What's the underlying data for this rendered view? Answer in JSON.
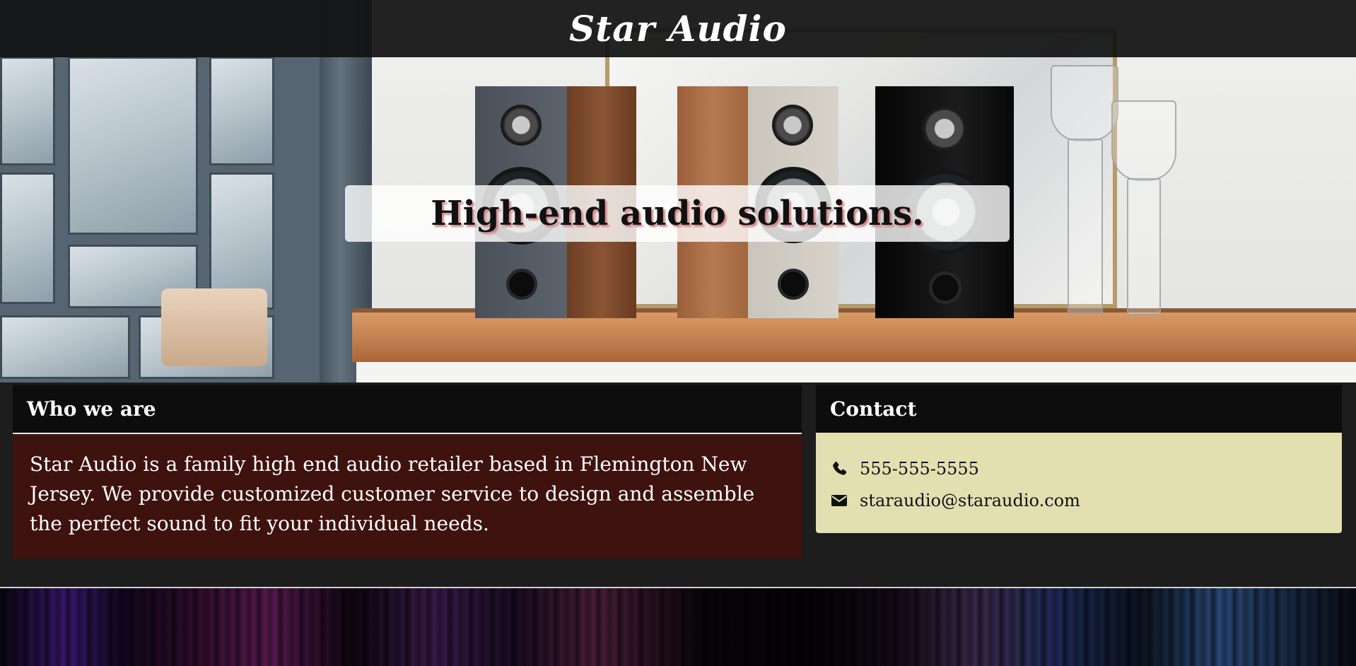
{
  "header": {
    "title": "Star Audio"
  },
  "hero": {
    "tagline": "High-end audio solutions.",
    "image_description_icon": "speakers-photo"
  },
  "about": {
    "heading": "Who we are",
    "body": "Star Audio is a family high end audio retailer based in Flemington New Jersey. We provide customized customer service to design and assemble the perfect sound to fit your individual needs."
  },
  "contact": {
    "heading": "Contact",
    "items": [
      {
        "icon": "phone-icon",
        "text": "555-555-5555"
      },
      {
        "icon": "envelope-icon",
        "text": "staraudio@staraudio.com"
      }
    ]
  },
  "colors": {
    "header_bg": "#121212",
    "about_body_bg": "#3e120e",
    "contact_body_bg": "#e2dfb1",
    "card_head_bg": "#0d0d0d",
    "page_bg": "#1d1d1d"
  }
}
